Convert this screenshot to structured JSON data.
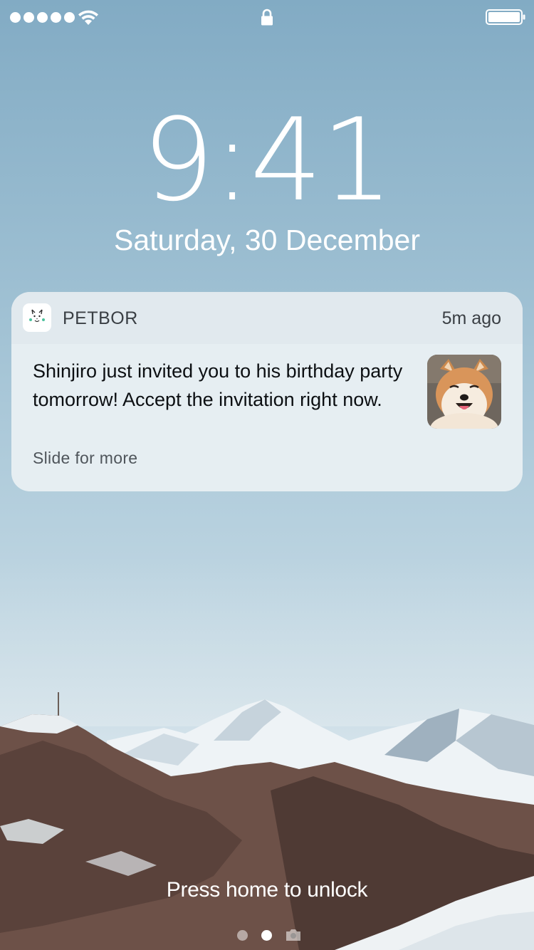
{
  "status_bar": {
    "signal_bars": 5,
    "wifi_icon": "wifi-icon",
    "lock_icon": "lock-icon",
    "battery_icon": "battery-icon",
    "battery_level": 1.0
  },
  "lock_screen": {
    "time": "9:41",
    "date": "Saturday, 30 December"
  },
  "notification": {
    "app_icon": "petbor-app-icon",
    "app_name": "PETBOR",
    "time_ago": "5m ago",
    "message": "Shinjiro just invited you to his birthday party tomorrow! Accept the invitation right now.",
    "more_hint": "Slide for more",
    "thumbnail": "shiba-inu-dog-photo"
  },
  "footer": {
    "unlock_hint": "Press home to unlock",
    "pages": 2,
    "active_page": 2,
    "camera_icon": "camera-icon"
  }
}
